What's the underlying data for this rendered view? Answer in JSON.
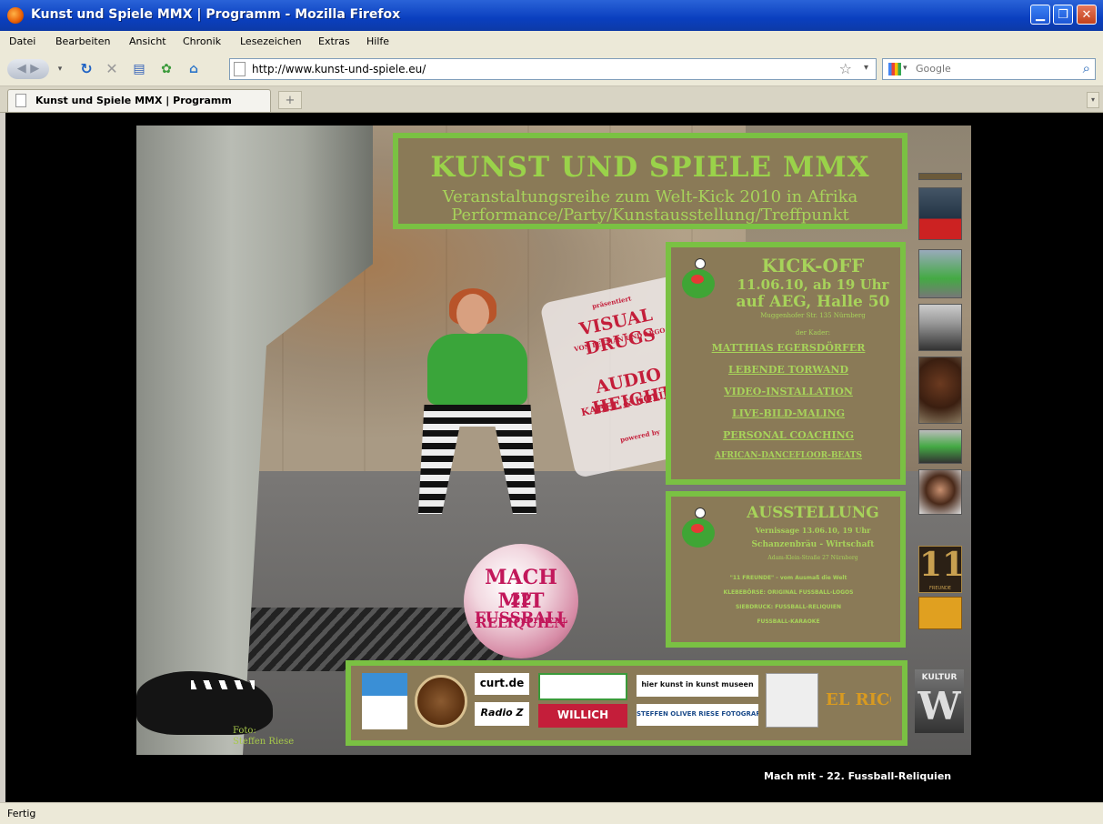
{
  "window": {
    "title": "Kunst und Spiele MMX | Programm - Mozilla Firefox"
  },
  "menu": [
    "Datei",
    "Bearbeiten",
    "Ansicht",
    "Chronik",
    "Lesezeichen",
    "Extras",
    "Hilfe"
  ],
  "toolbar": {
    "url": "http://www.kunst-und-spiele.eu/",
    "search_placeholder": "Google"
  },
  "tab": {
    "label": "Kunst und Spiele MMX | Programm",
    "new_tab": "+"
  },
  "page": {
    "header": {
      "title": "KUNST UND SPIELE MMX",
      "line1": "Veranstaltungsreihe zum Welt-Kick 2010 in Afrika",
      "line2": "Performance/Party/Kunstausstellung/Treffpunkt"
    },
    "kickoff": {
      "title": "KICK-OFF",
      "date": "11.06.10, ab 19 Uhr",
      "venue": "auf AEG, Halle 50",
      "address": "Muggenhofer Str. 135 Nürnberg",
      "intro": "der Kader:",
      "items": [
        {
          "label": "MATTHIAS EGERSDÖRFER"
        },
        {
          "label": "LEBENDE TORWAND"
        },
        {
          "label": "VIDEO-INSTALLATION"
        },
        {
          "label": "LIVE-BILD-MALING"
        },
        {
          "label": "PERSONAL COACHING"
        },
        {
          "label": "AFRICAN-DANCEFLOOR-BEATS"
        }
      ]
    },
    "exhibition": {
      "title": "AUSSTELLUNG",
      "vernissage": "Vernissage 13.06.10, 19 Uhr",
      "place": "Schanzenbräu - Wirtschaft",
      "address": "Adam-Klein-Straße 27 Nürnberg",
      "details": [
        "\"11 FREUNDE\" - vom Ausmaß die Welt",
        "KLEBEBÖRSE: ORIGINAL FUSSBALL-LOGOS",
        "SIEBDRUCK: FUSSBALL-RELIQUIEN",
        "FUSSBALL-KARAOKE"
      ]
    },
    "visual_card": {
      "small_top": "präsentiert",
      "visual_drugs": "VISUAL DRUGS",
      "visual_sub": "VON LEEMAN UND ARGO",
      "audio": "AUDIO HEIGHT",
      "audio_sub": "KABEL & KOLIBRI",
      "small_bottom": "powered by"
    },
    "ball": {
      "line1": "MACH MIT",
      "line2": "22 FUSSBALL",
      "line3": "RELIQUIEN"
    },
    "sidebar": {
      "elf_number": "11",
      "elf_label": "FREUNDE",
      "kultur_label": "KULTUR"
    },
    "sponsors": [
      "curt.de",
      "Radio Z",
      "WILLICH",
      "hier kunst in kunst museen",
      "STEFFEN OLIVER RIESE FOTOGRAFIE",
      "EL RICO"
    ],
    "photo_credit": {
      "line1": "Foto:",
      "line2": "Steffen Riese"
    },
    "caption": "Mach mit - 22. Fussball-Reliquien"
  },
  "status": "Fertig"
}
